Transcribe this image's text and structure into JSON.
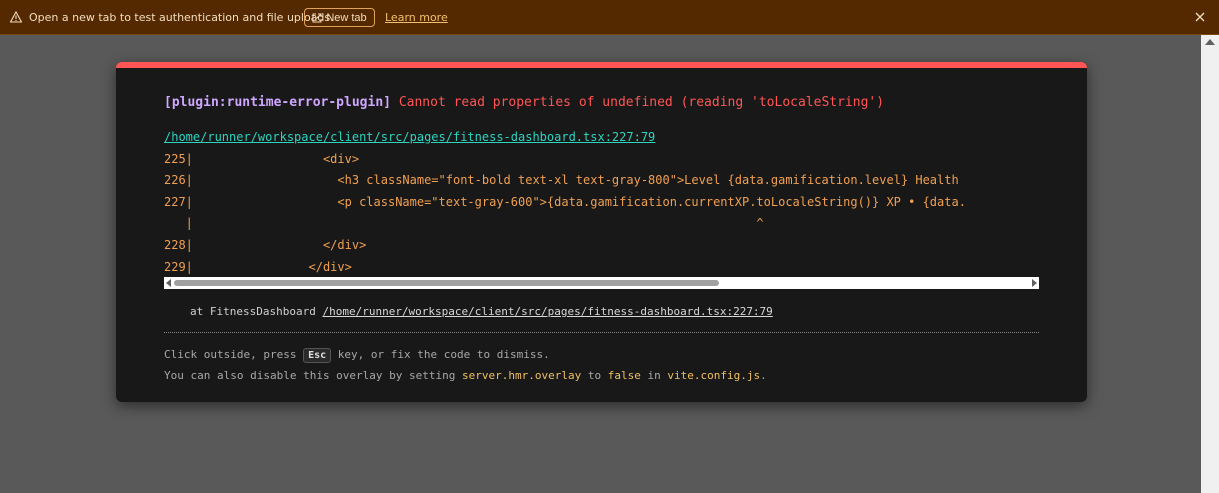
{
  "banner": {
    "message": "Open a new tab to test authentication and file uploads.",
    "new_tab_label": "New tab",
    "learn_more_label": "Learn more",
    "colors": {
      "background": "#542900",
      "accent": "#f0c070"
    }
  },
  "overlay": {
    "plugin": "[plugin:runtime-error-plugin]",
    "message": "Cannot read properties of undefined (reading 'toLocaleString')",
    "file": "/home/runner/workspace/client/src/pages/fitness-dashboard.tsx:227:79",
    "code_lines": [
      {
        "text": "225|                  <div>"
      },
      {
        "text": "226|                    <h3 className=\"font-bold text-xl text-gray-800\">Level {data.gamification.level} Health"
      },
      {
        "text": "227|                    <p className=\"text-gray-600\">{data.gamification.currentXP.toLocaleString()} XP • {data."
      },
      {
        "text": "   |                                                                              ^"
      },
      {
        "text": "228|                  </div>"
      },
      {
        "text": "229|                </div>"
      }
    ],
    "stack_prefix": "at FitnessDashboard",
    "stack_location": "/home/runner/workspace/client/src/pages/fitness-dashboard.tsx:227:79",
    "tip1_a": "Click outside, press",
    "tip1_key": "Esc",
    "tip1_b": "key, or fix the code to dismiss.",
    "tip2_a": "You can also disable this overlay by setting",
    "tip2_code": "server.hmr.overlay",
    "tip2_b": "to",
    "tip2_false": "false",
    "tip2_c": "in",
    "tip2_file": "vite.config.js",
    "tip2_d": ".",
    "colors": {
      "error": "#ff5555",
      "plugin": "#cfa7ff",
      "file": "#2dd4bf",
      "code": "#f0a050"
    }
  }
}
